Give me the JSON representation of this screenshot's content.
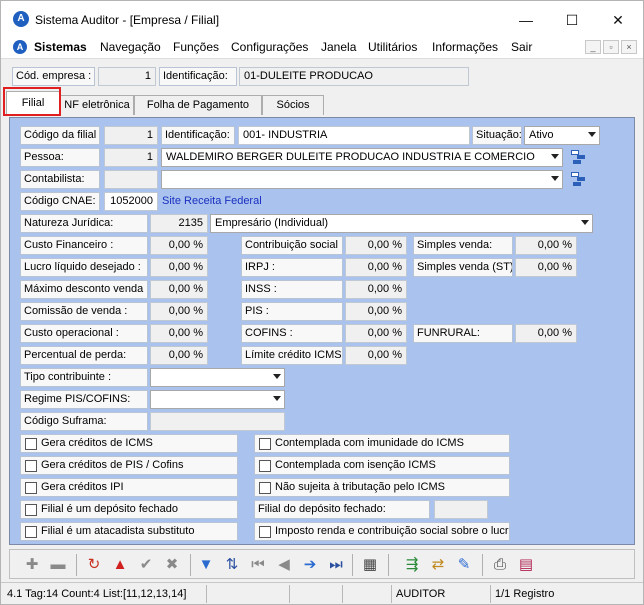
{
  "window": {
    "title": "Sistema Auditor - [Empresa / Filial]",
    "minimize": "—",
    "maximize": "☐",
    "close": "✕"
  },
  "menu": {
    "items": [
      "Sistemas",
      "Navegação",
      "Funções",
      "Configurações",
      "Janela",
      "Utilitários",
      "Informações",
      "Sair"
    ]
  },
  "empresa": {
    "cod_label": "Cód. empresa :",
    "cod_value": "1",
    "id_label": "Identificação:",
    "id_value": "01-DULEITE PRODUCAO"
  },
  "tabs": [
    "Filial",
    "NF eletrônica",
    "Folha de Pagamento",
    "Sócios"
  ],
  "filial": {
    "codigo_label": "Código da filial :",
    "codigo_value": "1",
    "identificacao_label": "Identificação:",
    "identificacao_value": "001- INDUSTRIA",
    "situacao_label": "Situação:",
    "situacao_value": "Ativo",
    "pessoa_label": "Pessoa:",
    "pessoa_code": "1",
    "pessoa_value": "WALDEMIRO BERGER DULEITE PRODUCAO INDUSTRIA E COMERCIO",
    "contabilista_label": "Contabilista:",
    "contabilista_code": "",
    "contabilista_value": "",
    "cnae_label": "Código CNAE:",
    "cnae_value": "1052000",
    "cnae_link": "Site Receita Federal",
    "natureza_label": "Natureza Jurídica:",
    "natureza_code": "2135",
    "natureza_value": "Empresário (Individual)",
    "custo_financeiro_label": "Custo Financeiro :",
    "custo_financeiro_value": "0,00 %",
    "lucro_label": "Lucro líquido desejado :",
    "lucro_value": "0,00 %",
    "max_desconto_label": "Máximo desconto venda :",
    "max_desconto_value": "0,00 %",
    "comissao_label": "Comissão de venda :",
    "comissao_value": "0,00 %",
    "custo_operacional_label": "Custo operacional :",
    "custo_operacional_value": "0,00 %",
    "perda_label": "Percentual de perda:",
    "perda_value": "0,00 %",
    "contrib_social_label": "Contribuição social :",
    "contrib_social_value": "0,00 %",
    "irpj_label": "IRPJ :",
    "irpj_value": "0,00 %",
    "inss_label": "INSS :",
    "inss_value": "0,00 %",
    "pis_label": "PIS :",
    "pis_value": "0,00 %",
    "cofins_label": "COFINS :",
    "cofins_value": "0,00 %",
    "limite_icms_label": "Límite crédito ICMS:",
    "limite_icms_value": "0,00 %",
    "simples_label": "Simples venda:",
    "simples_value": "0,00 %",
    "simples_st_label": "Simples venda (ST):",
    "simples_st_value": "0,00 %",
    "funrural_label": "FUNRURAL:",
    "funrural_value": "0,00 %",
    "tipo_contribuinte_label": "Tipo contribuinte :",
    "tipo_contribuinte_value": "",
    "regime_label": "Regime PIS/COFINS:",
    "regime_value": "",
    "suframa_label": "Código Suframa:",
    "suframa_value": "",
    "chk_icms": "Gera créditos de ICMS",
    "chk_pis": "Gera créditos de PIS / Cofins",
    "chk_ipi": "Gera créditos IPI",
    "chk_deposito": "Filial é um depósito fechado",
    "chk_atacadista": "Filial é um atacadista substituto",
    "chk_imunidade": "Contemplada com imunidade do ICMS",
    "chk_isencao": "Contemplada com isenção ICMS",
    "chk_nao_sujeita": "Não sujeita à tributação pelo ICMS",
    "filial_deposito_label": "Filial do depósito fechado:",
    "filial_deposito_value": "",
    "chk_imposto_renda": "Imposto renda e contribuição social sobre o lucro"
  },
  "toolbar": {
    "icons": [
      "add-icon",
      "remove-icon",
      "refresh-icon",
      "warning-icon",
      "confirm-icon",
      "cancel-icon",
      "filter-icon",
      "sort-icon",
      "first-icon",
      "prev-icon",
      "next-icon",
      "last-icon",
      "calculator-icon",
      "export-icon",
      "transfer-icon",
      "edit-icon",
      "print-icon",
      "report-icon"
    ]
  },
  "status": {
    "info": "4.1 Tag:14 Count:4 List:[11,12,13,14]",
    "user": "AUDITOR",
    "registro": "1/1 Registro"
  },
  "colors": {
    "panel": "#a9c3ee",
    "highlight": "#e02020",
    "link": "#1a2fc0"
  }
}
